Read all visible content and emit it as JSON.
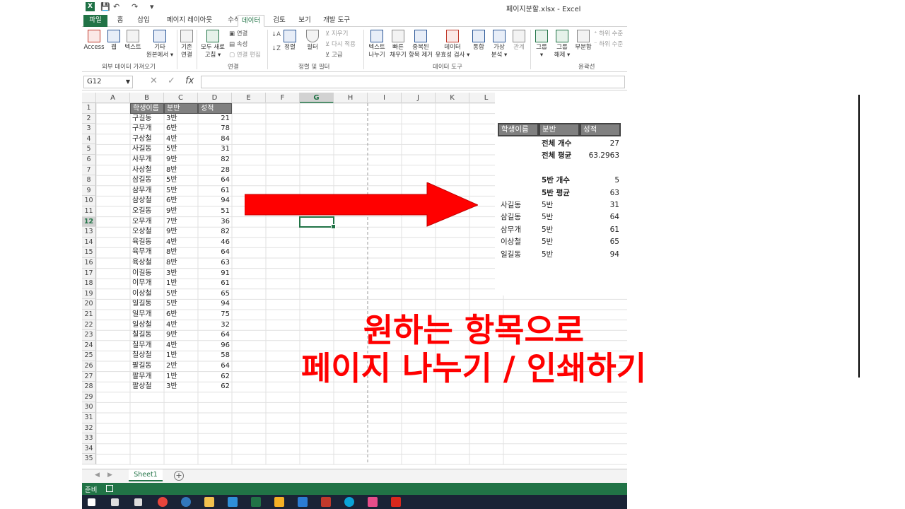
{
  "window": {
    "title": "페이지분할.xlsx - Excel",
    "app_logo": "X"
  },
  "tabs": [
    "파일",
    "홈",
    "삽입",
    "페이지 레이아웃",
    "수식",
    "데이터",
    "검토",
    "보기",
    "개발 도구"
  ],
  "ribbon": {
    "access": "Access",
    "web": "웹",
    "text": "텍스트",
    "other1": "기타",
    "other2": "원본에서 ▾",
    "existing1": "기존",
    "existing2": "연결",
    "refresh1": "모두 새로",
    "refresh2": "고침 ▾",
    "conn": "연결",
    "props": "속성",
    "edit_links": "연결 편집",
    "sort": "정렬",
    "filter": "필터",
    "clear": "지우기",
    "reapply": "다시 적용",
    "advanced": "고급",
    "ttc1": "텍스트",
    "ttc2": "나누기",
    "flash1": "빠른",
    "flash2": "채우기",
    "dup1": "중복된",
    "dup2": "항목 제거",
    "valid1": "데이터",
    "valid2": "유효성 검사 ▾",
    "consol": "통합",
    "whatif1": "가상",
    "whatif2": "분석 ▾",
    "rel": "관계",
    "group1": "그룹",
    "group2": "▾",
    "ungroup1": "그룹",
    "ungroup2": "해제 ▾",
    "subtotal": "부분합",
    "show_detail": "하위 수준",
    "hide_detail": "하위 수준",
    "grp_external": "외부 데이터 가져오기",
    "grp_conn": "연결",
    "grp_sort": "정렬 및 필터",
    "grp_tools": "데이터 도구",
    "grp_outline": "윤곽선"
  },
  "formula": {
    "namebox": "G12",
    "cancel": "✕",
    "enter": "✓",
    "fx": "fx",
    "value": ""
  },
  "columns": [
    "A",
    "B",
    "C",
    "D",
    "E",
    "F",
    "G",
    "H",
    "I",
    "J",
    "K",
    "L"
  ],
  "selected_cell": {
    "col": "G",
    "row": 12
  },
  "table": {
    "headers": [
      "학생이름",
      "분반",
      "성적"
    ],
    "rows": [
      [
        "구길동",
        "3반",
        "21"
      ],
      [
        "구무개",
        "6반",
        "78"
      ],
      [
        "구상철",
        "4반",
        "84"
      ],
      [
        "사길동",
        "5반",
        "31"
      ],
      [
        "사무개",
        "9반",
        "82"
      ],
      [
        "사상철",
        "8반",
        "28"
      ],
      [
        "삼길동",
        "5반",
        "64"
      ],
      [
        "삼무개",
        "5반",
        "61"
      ],
      [
        "삼상철",
        "6반",
        "94"
      ],
      [
        "오길동",
        "9반",
        "51"
      ],
      [
        "오무개",
        "7반",
        "36"
      ],
      [
        "오상철",
        "9반",
        "82"
      ],
      [
        "육길동",
        "4반",
        "46"
      ],
      [
        "육무개",
        "8반",
        "64"
      ],
      [
        "육상철",
        "8반",
        "63"
      ],
      [
        "이길동",
        "3반",
        "91"
      ],
      [
        "이무개",
        "1반",
        "61"
      ],
      [
        "이상철",
        "5반",
        "65"
      ],
      [
        "일길동",
        "5반",
        "94"
      ],
      [
        "일무개",
        "6반",
        "75"
      ],
      [
        "일상철",
        "4반",
        "32"
      ],
      [
        "칠길동",
        "9반",
        "64"
      ],
      [
        "칠무개",
        "4반",
        "96"
      ],
      [
        "칠상철",
        "1반",
        "58"
      ],
      [
        "팔길동",
        "2반",
        "64"
      ],
      [
        "팔무개",
        "1반",
        "62"
      ],
      [
        "팔상철",
        "3반",
        "62"
      ]
    ]
  },
  "row_numbers": [
    "1",
    "2",
    "3",
    "4",
    "5",
    "6",
    "7",
    "8",
    "9",
    "10",
    "11",
    "12",
    "13",
    "14",
    "15",
    "16",
    "17",
    "18",
    "19",
    "20",
    "21",
    "22",
    "23",
    "24",
    "25",
    "26",
    "27",
    "28",
    "29",
    "30",
    "31",
    "32",
    "33",
    "34",
    "35"
  ],
  "sheet": {
    "name": "Sheet1",
    "add": "+",
    "prev": "◀",
    "next": "▶"
  },
  "status": {
    "text": "준비"
  },
  "preview": {
    "headers": [
      "학생이름",
      "분반",
      "성적"
    ],
    "total_count_label": "전체 개수",
    "total_count": "27",
    "total_avg_label": "전체 평균",
    "total_avg": "63.2963",
    "class_count_label": "5반 개수",
    "class_count": "5",
    "class_avg_label": "5반 평균",
    "class_avg": "63",
    "rows": [
      [
        "사길동",
        "5반",
        "31"
      ],
      [
        "삼길동",
        "5반",
        "64"
      ],
      [
        "삼무개",
        "5반",
        "61"
      ],
      [
        "이상철",
        "5반",
        "65"
      ],
      [
        "일길동",
        "5반",
        "94"
      ]
    ]
  },
  "caption": {
    "line1": "원하는 항목으로",
    "line2": "페이지 나누기 / 인쇄하기"
  },
  "colors": {
    "excel_green": "#217346",
    "header_gray": "#808080",
    "arrow_red": "#ff0000"
  },
  "taskbar_icons": [
    "windows-icon",
    "search-icon",
    "task-view-icon",
    "chrome-icon",
    "edge-icon",
    "file-explorer-icon",
    "app-icon",
    "excel-icon",
    "store-icon",
    "mail-icon",
    "app2-icon",
    "edge-new-icon",
    "paint-icon",
    "acrobat-icon"
  ]
}
